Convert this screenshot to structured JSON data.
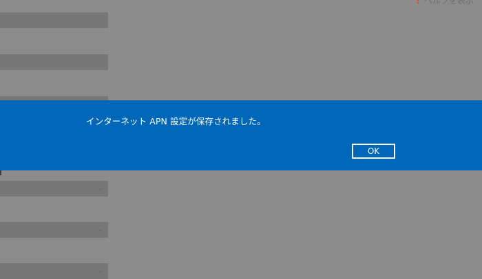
{
  "header": {
    "help_link_label": "ヘルプを表示",
    "help_icon": "help-bubble-icon"
  },
  "background_form": {
    "fields": [
      "",
      "",
      ""
    ],
    "dropdowns": [
      "",
      "",
      ""
    ]
  },
  "dialog": {
    "message": "インターネット APN 設定が保存されました。",
    "ok_label": "OK"
  },
  "colors": {
    "dialog_accent": "#0067b8",
    "overlay": "#8c8c8c"
  }
}
